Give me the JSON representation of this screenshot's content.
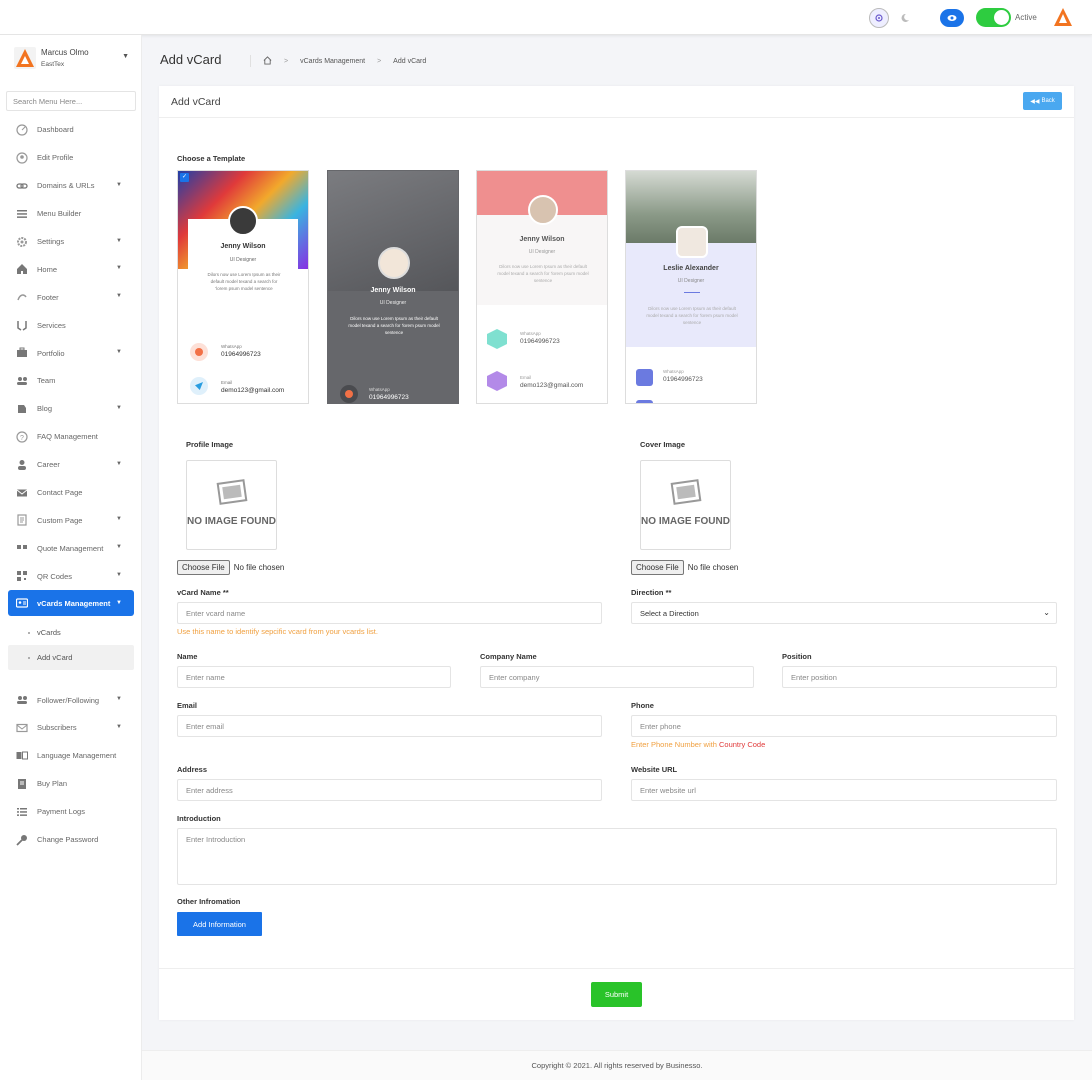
{
  "topbar": {
    "status_label": "Active"
  },
  "sidebar": {
    "user_name": "Marcus Olmo",
    "company": "EastTex",
    "search_placeholder": "Search Menu Here...",
    "items": [
      {
        "label": "Dashboard",
        "icon": "dashboard-icon",
        "arrow": false
      },
      {
        "label": "Edit Profile",
        "icon": "user-circle-icon",
        "arrow": false
      },
      {
        "label": "Domains & URLs",
        "icon": "link-icon",
        "arrow": true
      },
      {
        "label": "Menu Builder",
        "icon": "bars-icon",
        "arrow": false
      },
      {
        "label": "Settings",
        "icon": "gear-icon",
        "arrow": true
      },
      {
        "label": "Home",
        "icon": "home-icon",
        "arrow": true
      },
      {
        "label": "Footer",
        "icon": "footer-icon",
        "arrow": true
      },
      {
        "label": "Services",
        "icon": "hands-icon",
        "arrow": false
      },
      {
        "label": "Portfolio",
        "icon": "portfolio-icon",
        "arrow": true
      },
      {
        "label": "Team",
        "icon": "users-icon",
        "arrow": false
      },
      {
        "label": "Blog",
        "icon": "blog-icon",
        "arrow": true
      },
      {
        "label": "FAQ Management",
        "icon": "question-icon",
        "arrow": false
      },
      {
        "label": "Career",
        "icon": "career-icon",
        "arrow": true
      },
      {
        "label": "Contact Page",
        "icon": "envelope-icon",
        "arrow": false
      },
      {
        "label": "Custom Page",
        "icon": "page-icon",
        "arrow": true
      },
      {
        "label": "Quote Management",
        "icon": "quote-icon",
        "arrow": true
      },
      {
        "label": "QR Codes",
        "icon": "qrcode-icon",
        "arrow": true
      },
      {
        "label": "vCards Management",
        "icon": "vcard-icon",
        "arrow": true
      }
    ],
    "sub_items": [
      "vCards",
      "Add vCard"
    ],
    "items_after": [
      {
        "label": "Follower/Following",
        "icon": "followers-icon",
        "arrow": true
      },
      {
        "label": "Subscribers",
        "icon": "subscribers-icon",
        "arrow": true
      },
      {
        "label": "Language Management",
        "icon": "language-icon",
        "arrow": false
      },
      {
        "label": "Buy Plan",
        "icon": "cart-icon",
        "arrow": false
      },
      {
        "label": "Payment Logs",
        "icon": "list-icon",
        "arrow": false
      },
      {
        "label": "Change Password",
        "icon": "key-icon",
        "arrow": false
      }
    ]
  },
  "header": {
    "title": "Add vCard",
    "breadcrumb": [
      "vCards Management",
      "Add vCard"
    ]
  },
  "card": {
    "title": "Add vCard",
    "back_label": "Back"
  },
  "form": {
    "choose_template": "Choose a Template",
    "templates": [
      {
        "name": "Jenny Wilson",
        "role": "UI Designer",
        "desc": "Dilors now use Lorem Ipsum as their default model texand a search for 'lorem psum model sentence",
        "whatsapp_label": "WhatsApp",
        "phone": "01964996723",
        "email_label": "Email",
        "email": "demo123@gmail.com"
      },
      {
        "name": "Jenny Wilson",
        "role": "UI Designer",
        "desc": "Dilors now use Lorem Ipsum as their default model texand a search for 'lorem psum model sentence",
        "whatsapp_label": "WhatsApp",
        "phone": "01964996723"
      },
      {
        "name": "Jenny Wilson",
        "role": "UI Designer",
        "desc": "Dilors now use Lorem Ipsum as their default model texand a search for 'lorem psum model sentence",
        "whatsapp_label": "WhatsApp",
        "phone": "01964996723",
        "email_label": "Email",
        "email": "demo123@gmail.com"
      },
      {
        "name": "Leslie Alexander",
        "role": "UI Designer",
        "desc": "Dilors now use Lorem Ipsum as their default model texand a search for 'lorem psum model sentence",
        "whatsapp_label": "WhatsApp",
        "phone": "01964996723"
      }
    ],
    "profile_image_label": "Profile Image",
    "cover_image_label": "Cover Image",
    "no_image_text": "NO IMAGE FOUND",
    "choose_file": "Choose File",
    "no_file": "No file chosen",
    "vcard_name_label": "vCard Name **",
    "vcard_name_placeholder": "Enter vcard name",
    "vcard_hint": "Use this name to identify sepcific vcard from your vcards list.",
    "direction_label": "Direction **",
    "direction_value": "Select a Direction",
    "name_label": "Name",
    "name_placeholder": "Enter name",
    "company_label": "Company Name",
    "company_placeholder": "Enter company",
    "position_label": "Position",
    "position_placeholder": "Enter position",
    "email_label": "Email",
    "email_placeholder": "Enter email",
    "phone_label": "Phone",
    "phone_placeholder": "Enter phone",
    "phone_hint": "Enter Phone Number with",
    "phone_hint_highlight": "Country Code",
    "address_label": "Address",
    "address_placeholder": "Enter address",
    "website_label": "Website URL",
    "website_placeholder": "Enter website url",
    "intro_label": "Introduction",
    "intro_placeholder": "Enter Introduction",
    "other_label": "Other Infromation",
    "add_info_label": "Add Information",
    "submit_label": "Submit"
  },
  "footer": {
    "copyright": "Copyright © 2021. All rights reserved by Businesso."
  },
  "colors": {
    "primary": "#1a73e8",
    "success": "#29c329",
    "hint": "#f0a040",
    "back": "#4aa8f0",
    "toggle": "#2ecc40"
  }
}
